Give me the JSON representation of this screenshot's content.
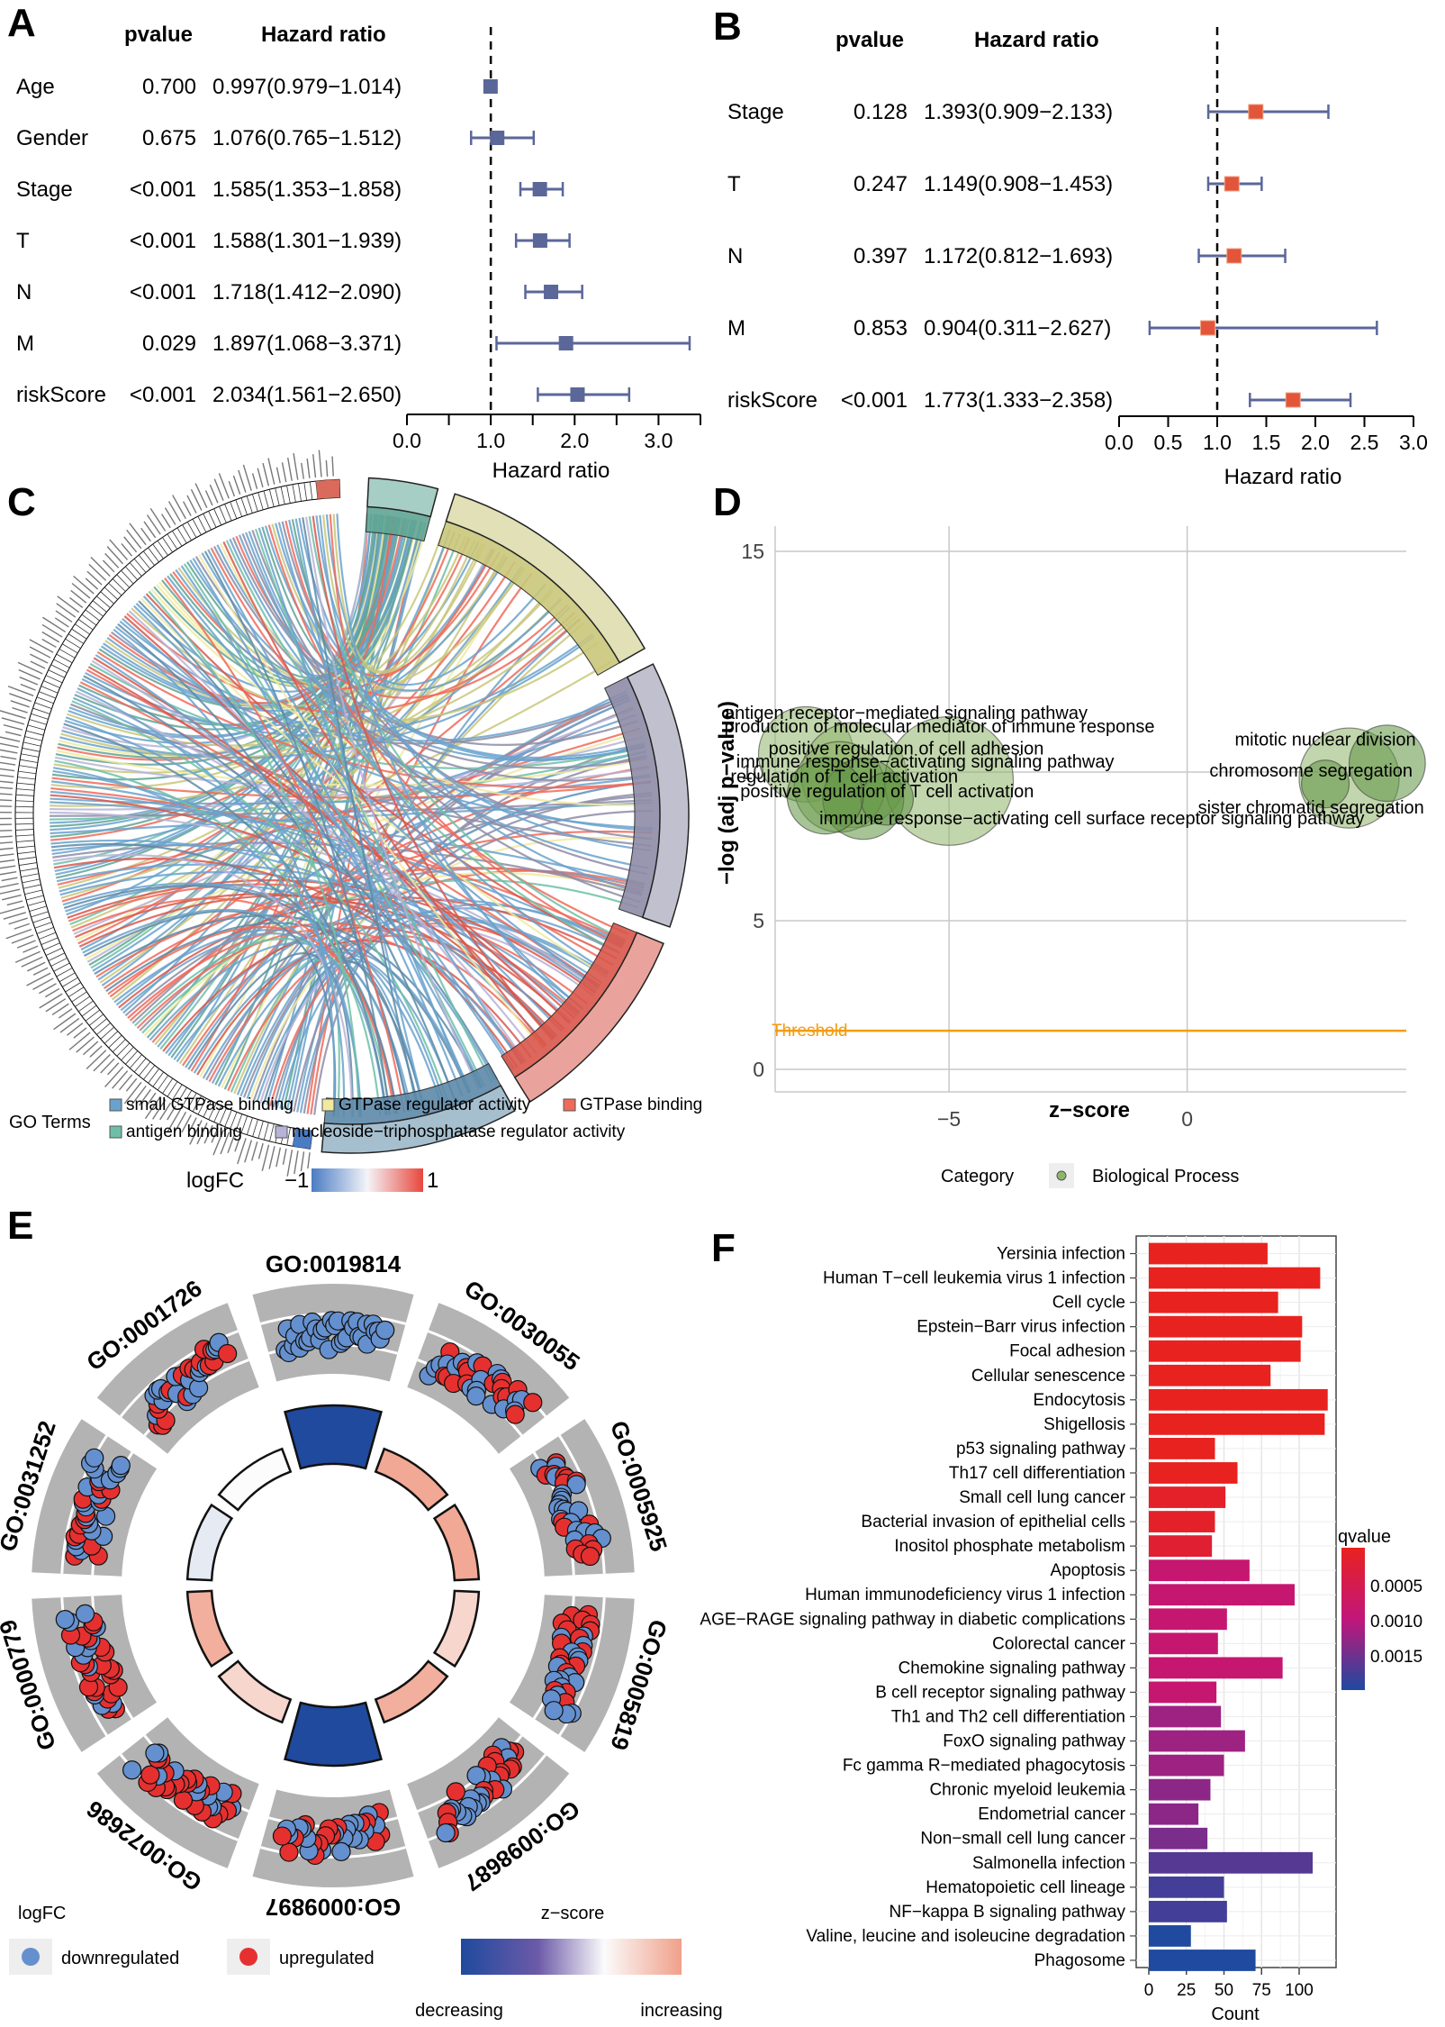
{
  "figure": {
    "panel_letters": [
      "A",
      "B",
      "C",
      "D",
      "E",
      "F"
    ]
  },
  "chart_data": [
    {
      "panel": "A",
      "type": "forest",
      "header_pvalue": "pvalue",
      "header_hr": "Hazard ratio",
      "xlabel": "Hazard ratio",
      "xlim": [
        0,
        3.5
      ],
      "xticks": [
        0.0,
        0.5,
        1.0,
        1.5,
        2.0,
        2.5,
        3.0,
        3.5
      ],
      "xtick_labels": [
        "0.0",
        "",
        "1.0",
        "",
        "2.0",
        "",
        "3.0",
        ""
      ],
      "reference_line": 1.0,
      "marker_color": "#5b6799",
      "rows": [
        {
          "name": "Age",
          "pvalue": "0.700",
          "hr_text": "0.997(0.979−1.014)",
          "hr": 0.997,
          "lo": 0.979,
          "hi": 1.014
        },
        {
          "name": "Gender",
          "pvalue": "0.675",
          "hr_text": "1.076(0.765−1.512)",
          "hr": 1.076,
          "lo": 0.765,
          "hi": 1.512
        },
        {
          "name": "Stage",
          "pvalue": "<0.001",
          "hr_text": "1.585(1.353−1.858)",
          "hr": 1.585,
          "lo": 1.353,
          "hi": 1.858
        },
        {
          "name": "T",
          "pvalue": "<0.001",
          "hr_text": "1.588(1.301−1.939)",
          "hr": 1.588,
          "lo": 1.301,
          "hi": 1.939
        },
        {
          "name": "N",
          "pvalue": "<0.001",
          "hr_text": "1.718(1.412−2.090)",
          "hr": 1.718,
          "lo": 1.412,
          "hi": 2.09
        },
        {
          "name": "M",
          "pvalue": "0.029",
          "hr_text": "1.897(1.068−3.371)",
          "hr": 1.897,
          "lo": 1.068,
          "hi": 3.371
        },
        {
          "name": "riskScore",
          "pvalue": "<0.001",
          "hr_text": "2.034(1.561−2.650)",
          "hr": 2.034,
          "lo": 1.561,
          "hi": 2.65
        }
      ]
    },
    {
      "panel": "B",
      "type": "forest",
      "header_pvalue": "pvalue",
      "header_hr": "Hazard ratio",
      "xlabel": "Hazard ratio",
      "xlim": [
        0,
        3.0
      ],
      "xticks": [
        0.0,
        0.5,
        1.0,
        1.5,
        2.0,
        2.5,
        3.0
      ],
      "xtick_labels": [
        "0.0",
        "0.5",
        "1.0",
        "1.5",
        "2.0",
        "2.5",
        "3.0"
      ],
      "reference_line": 1.0,
      "marker_color": "#e2553a",
      "ci_color": "#5b6799",
      "rows": [
        {
          "name": "Stage",
          "pvalue": "0.128",
          "hr_text": "1.393(0.909−2.133)",
          "hr": 1.393,
          "lo": 0.909,
          "hi": 2.133
        },
        {
          "name": "T",
          "pvalue": "0.247",
          "hr_text": "1.149(0.908−1.453)",
          "hr": 1.149,
          "lo": 0.908,
          "hi": 1.453
        },
        {
          "name": "N",
          "pvalue": "0.397",
          "hr_text": "1.172(0.812−1.693)",
          "hr": 1.172,
          "lo": 0.812,
          "hi": 1.693
        },
        {
          "name": "M",
          "pvalue": "0.853",
          "hr_text": "0.904(0.311−2.627)",
          "hr": 0.904,
          "lo": 0.311,
          "hi": 2.627
        },
        {
          "name": "riskScore",
          "pvalue": "<0.001",
          "hr_text": "1.773(1.333−2.358)",
          "hr": 1.773,
          "lo": 1.333,
          "hi": 2.358
        }
      ]
    },
    {
      "panel": "C",
      "type": "chord",
      "terms": [
        {
          "name": "antigen binding",
          "color": "#5fa594",
          "share": 0.07
        },
        {
          "name": "GTPase regulator activity",
          "color": "#c9c77a",
          "share": 0.25
        },
        {
          "name": "nucleoside−triphosphatase regulator activity",
          "color": "#8e8ca6",
          "share": 0.27
        },
        {
          "name": "GTPase binding",
          "color": "#d9574a",
          "share": 0.21
        },
        {
          "name": "small GTPase binding",
          "color": "#5d8aa8",
          "share": 0.2
        }
      ],
      "legend_title": "GO Terms",
      "legend_items": [
        {
          "name": "small GTPase binding",
          "color": "#6aa2cc"
        },
        {
          "name": "GTPase regulator activity",
          "color": "#f0eaa0"
        },
        {
          "name": "GTPase binding",
          "color": "#ee6a5a"
        },
        {
          "name": "antigen binding",
          "color": "#6fbfa8"
        },
        {
          "name": "nucleoside−triphosphatase regulator activity",
          "color": "#b7b3d6"
        }
      ],
      "logfc_title": "logFC",
      "logfc_min": "−1",
      "logfc_max": "1",
      "logfc_low_color": "#4a7cc4",
      "logfc_high_color": "#e8473c"
    },
    {
      "panel": "D",
      "type": "scatter",
      "title": "",
      "xlabel": "z−score",
      "ylabel": "−log (adj p−value)",
      "xlim": [
        -8.65,
        4.6
      ],
      "xticks": [
        -5,
        0
      ],
      "xtick_labels": [
        "−5",
        "0"
      ],
      "yticks": [
        0,
        5,
        10,
        15
      ],
      "ytick_labels": [
        "0",
        "5",
        "10",
        "15"
      ],
      "threshold_label": "Threshold",
      "threshold": 1.3,
      "threshold_color": "#f39c12",
      "grid": true,
      "legend_title": "Category",
      "legend_item": "Biological Process",
      "bubble_color": "#8fb56a",
      "points": [
        {
          "x": -8.0,
          "y": 10.4,
          "r": 1.0,
          "label": "antigen receptor−mediated signaling pathway"
        },
        {
          "x": -7.0,
          "y": 9.9,
          "r": 1.1,
          "label": "production of molecular mediator of immune response"
        },
        {
          "x": -5.0,
          "y": 9.7,
          "r": 1.35,
          "label": "positive regulation of cell adhesion"
        },
        {
          "x": -7.3,
          "y": 9.5,
          "r": 0.95,
          "label": "immune response−activating signaling pathway"
        },
        {
          "x": -6.8,
          "y": 9.1,
          "r": 0.85,
          "label": "regulation of T cell activation"
        },
        {
          "x": -6.3,
          "y": 9.1,
          "r": 0.55,
          "label": "positive regulation of T cell activation"
        },
        {
          "x": -7.6,
          "y": 9.2,
          "r": 0.8,
          "label": "immune response−activating cell surface receptor signaling pathway"
        },
        {
          "x": 3.4,
          "y": 9.8,
          "r": 1.05,
          "label": "mitotic nuclear division"
        },
        {
          "x": 4.2,
          "y": 10.2,
          "r": 0.8,
          "label": "chromosome segregation"
        },
        {
          "x": 2.9,
          "y": 9.6,
          "r": 0.5,
          "label": "sister chromatid segregation"
        }
      ],
      "text_labels": [
        {
          "text": "antigen receptor−mediated signaling pathway",
          "x": -5.9,
          "y": 11.2
        },
        {
          "text": "production of molecular mediator of immune response",
          "x": -5.2,
          "y": 10.9
        },
        {
          "text": "positive regulation of cell adhesion",
          "x": -5.9,
          "y": 10.4
        },
        {
          "text": "immune response−activating signaling pathway",
          "x": -5.5,
          "y": 10.1
        },
        {
          "text": "regulation of T cell activation",
          "x": -7.2,
          "y": 9.65
        },
        {
          "text": "positive regulation of T cell activation",
          "x": -6.3,
          "y": 9.15
        },
        {
          "text": "immune response−activating cell surface receptor signaling pathway",
          "x": -2.0,
          "y": 8.25
        },
        {
          "text": "mitotic nuclear division",
          "x": 2.9,
          "y": 10.6
        },
        {
          "text": "chromosome segregation",
          "x": 2.6,
          "y": 9.85
        },
        {
          "text": "sister chromatid segregation",
          "x": 2.6,
          "y": 8.6
        }
      ]
    },
    {
      "panel": "E",
      "type": "circular",
      "terms": [
        {
          "id": "GO:0019814",
          "zscore_level": -1.0,
          "points": "down"
        },
        {
          "id": "GO:0030055",
          "zscore_level": 0.55,
          "points": "mixed"
        },
        {
          "id": "GO:0005925",
          "zscore_level": 0.55,
          "points": "mixed"
        },
        {
          "id": "GO:0005819",
          "zscore_level": 0.25,
          "points": "mixed"
        },
        {
          "id": "GO:0098687",
          "zscore_level": 0.5,
          "points": "mixed"
        },
        {
          "id": "GO:0009897",
          "zscore_level": -1.0,
          "points": "mixed"
        },
        {
          "id": "GO:0072686",
          "zscore_level": 0.25,
          "points": "mixed"
        },
        {
          "id": "GO:0000779",
          "zscore_level": 0.5,
          "points": "mixed"
        },
        {
          "id": "GO:0031252",
          "zscore_level": -0.1,
          "points": "mixed"
        },
        {
          "id": "GO:0001726",
          "zscore_level": 0.0,
          "points": "mixed"
        }
      ],
      "logfc_title": "logFC",
      "down_label": "downregulated",
      "up_label": "upregulated",
      "down_color": "#6590cf",
      "up_color": "#e63030",
      "zscore_title": "z−score",
      "zscore_low_label": "decreasing",
      "zscore_high_label": "increasing",
      "zscore_low_color": "#1f4a9e",
      "zscore_high_color": "#f0a08a"
    },
    {
      "panel": "F",
      "type": "bar",
      "orientation": "horizontal",
      "xlabel": "Count",
      "xlim": [
        0,
        122
      ],
      "xticks": [
        0,
        25,
        50,
        75,
        100
      ],
      "legend_title": "qvalue",
      "legend_ticks": [
        "0.0005",
        "0.0010",
        "0.0015"
      ],
      "color_low": "#e8221f",
      "color_high": "#1f4aa0",
      "categories": [
        "Yersinia infection",
        "Human T−cell leukemia virus 1 infection",
        "Cell cycle",
        "Epstein−Barr virus infection",
        "Focal adhesion",
        "Cellular senescence",
        "Endocytosis",
        "Shigellosis",
        "p53 signaling pathway",
        "Th17 cell differentiation",
        "Small cell lung cancer",
        "Bacterial invasion of epithelial cells",
        "Inositol phosphate metabolism",
        "Apoptosis",
        "Human immunodeficiency virus 1 infection",
        "AGE−RAGE signaling pathway in diabetic complications",
        "Colorectal cancer",
        "Chemokine signaling pathway",
        "B cell receptor signaling pathway",
        "Th1 and Th2 cell differentiation",
        "FoxO signaling pathway",
        "Fc gamma R−mediated phagocytosis",
        "Chronic myeloid leukemia",
        "Endometrial cancer",
        "Non−small cell lung cancer",
        "Salmonella infection",
        "Hematopoietic cell lineage",
        "NF−kappa B signaling pathway",
        "Valine, leucine and isoleucine degradation",
        "Phagosome"
      ],
      "values": [
        79,
        114,
        86,
        102,
        101,
        81,
        119,
        117,
        44,
        59,
        51,
        44,
        42,
        67,
        97,
        52,
        46,
        89,
        45,
        48,
        64,
        50,
        41,
        33,
        39,
        109,
        50,
        52,
        28,
        71
      ],
      "qvalues": [
        0.0001,
        0.0001,
        0.0001,
        0.0001,
        0.0001,
        0.0001,
        0.0001,
        0.0001,
        0.0001,
        0.0001,
        0.0002,
        0.0002,
        0.0003,
        0.0009,
        0.0009,
        0.0009,
        0.0009,
        0.0009,
        0.0009,
        0.0012,
        0.0012,
        0.0012,
        0.0013,
        0.0013,
        0.0014,
        0.0016,
        0.0017,
        0.0017,
        0.0019,
        0.0019
      ]
    }
  ]
}
